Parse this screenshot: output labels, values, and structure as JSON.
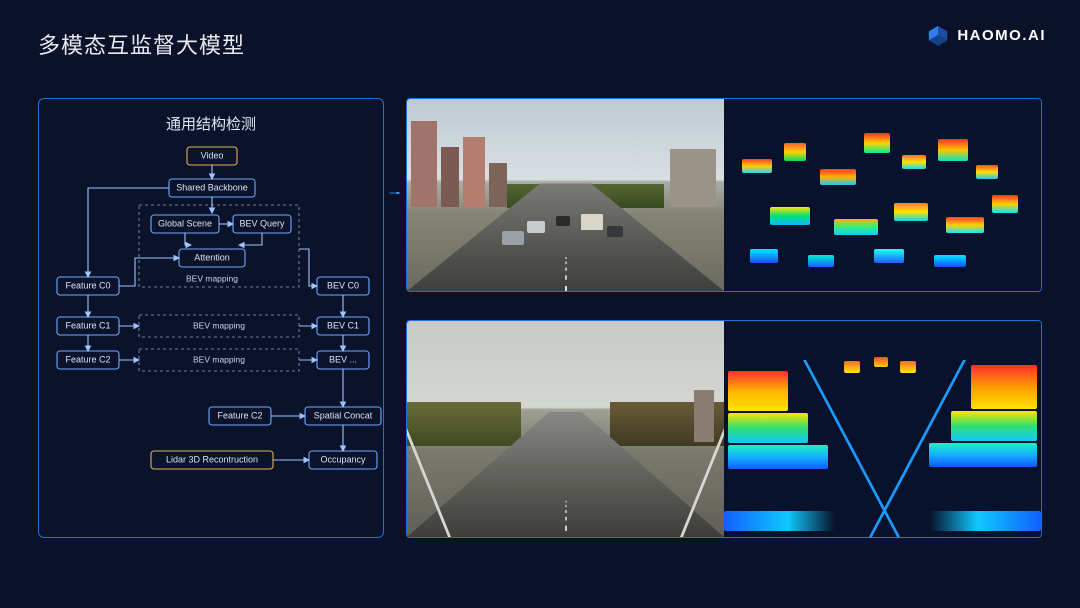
{
  "title": "多模态互监督大模型",
  "logo_text": "HAOMO.AI",
  "diagram": {
    "title": "通用结构检测",
    "nodes": {
      "video": "Video",
      "backbone": "Shared Backbone",
      "global_scene": "Global Scene",
      "bev_query": "BEV Query",
      "attention": "Attention",
      "bev_mapping_group": "BEV mapping",
      "feature_c0": "Feature C0",
      "feature_c1": "Feature C1",
      "feature_c2": "Feature C2",
      "bev_c0": "BEV C0",
      "bev_c1": "BEV C1",
      "bev_dots": "BEV ...",
      "bev_mapping_1": "BEV mapping",
      "bev_mapping_2": "BEV mapping",
      "feature_c2_b": "Feature C2",
      "spatial_concat": "Spatial Concat",
      "lidar": "Lidar 3D Recontruction",
      "occupancy": "Occupancy"
    }
  },
  "panels": {
    "top_left_alt": "driving-scene-camera-top",
    "top_right_alt": "bev-pointcloud-top",
    "bot_left_alt": "driving-scene-camera-bottom",
    "bot_right_alt": "bev-pointcloud-bottom"
  }
}
